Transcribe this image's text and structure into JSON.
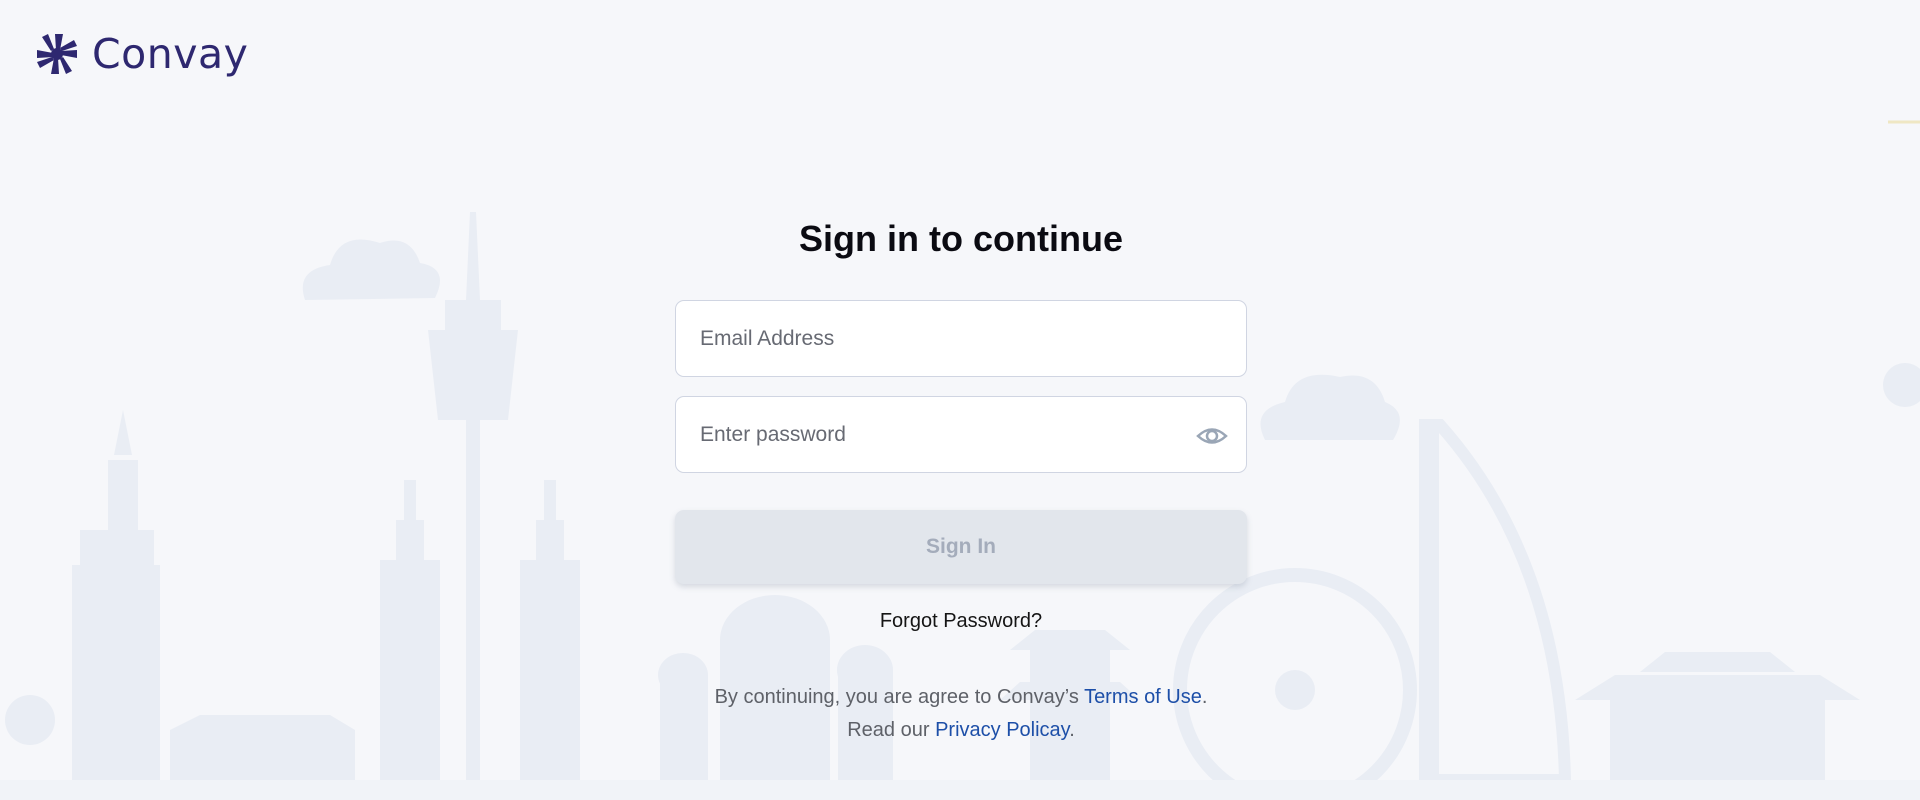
{
  "brand": {
    "name": "Convay",
    "color": "#2e2870"
  },
  "form": {
    "title": "Sign in to continue",
    "email_placeholder": "Email Address",
    "password_placeholder": "Enter password",
    "password_toggle_icon": "eye-icon",
    "submit_label": "Sign In",
    "forgot_label": "Forgot Password?"
  },
  "legal": {
    "prefix": "By continuing, you are agree to Convay’s ",
    "terms_label": "Terms of Use",
    "terms_suffix": ".",
    "read_prefix": "Read our ",
    "privacy_label": "Privacy Policay",
    "privacy_suffix": "."
  },
  "colors": {
    "background": "#f6f7fa",
    "link": "#1d4fa8",
    "button_disabled_bg": "#e2e6ec",
    "button_disabled_text": "#a4acbb"
  }
}
